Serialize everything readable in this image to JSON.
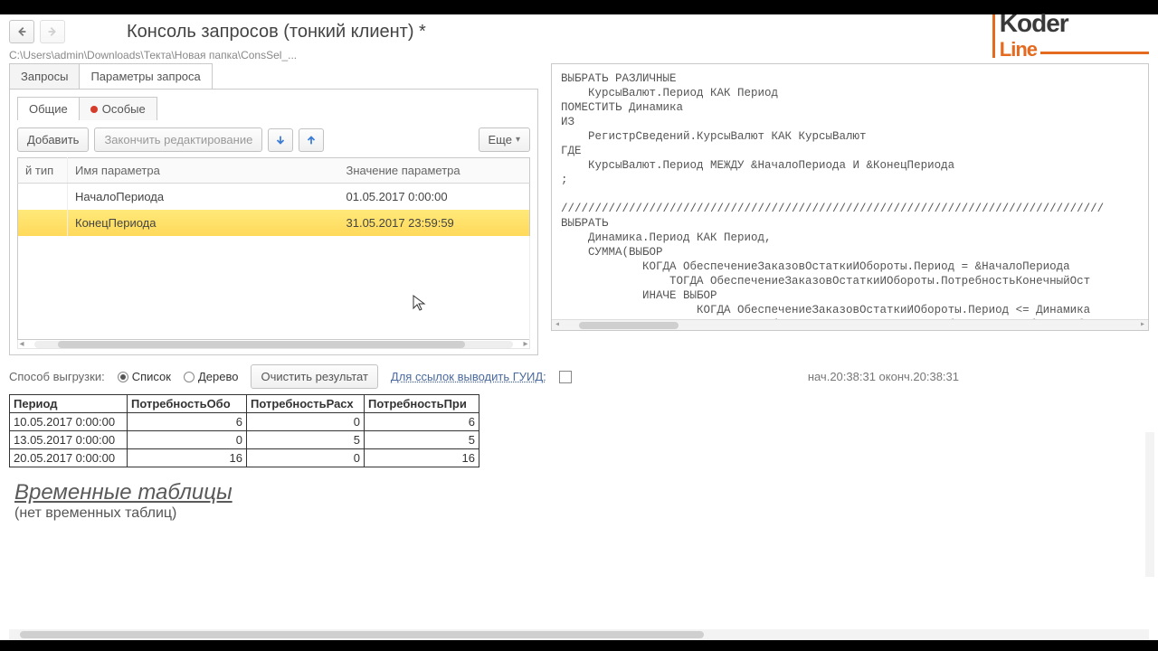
{
  "title": "Консоль запросов (тонкий клиент) *",
  "path": "C:\\Users\\admin\\Downloads\\Текта\\Новая папка\\ConsSel_...",
  "logo": {
    "top": "Koder",
    "bottom": "Line"
  },
  "tabs": {
    "queries": "Запросы",
    "params": "Параметры запроса"
  },
  "innerTabs": {
    "common": "Общие",
    "special": "Особые"
  },
  "toolbar": {
    "add": "Добавить",
    "finishEdit": "Закончить редактирование",
    "more": "Еще"
  },
  "paramHeaders": {
    "type": "й тип",
    "name": "Имя параметра",
    "value": "Значение параметра"
  },
  "params": [
    {
      "name": "НачалоПериода",
      "value": "01.05.2017 0:00:00"
    },
    {
      "name": "КонецПериода",
      "value": "31.05.2017 23:59:59"
    }
  ],
  "code": "ВЫБРАТЬ РАЗЛИЧНЫЕ\n    КурсыВалют.Период КАК Период\nПОМЕСТИТЬ Динамика\nИЗ\n    РегистрСведений.КурсыВалют КАК КурсыВалют\nГДЕ\n    КурсыВалют.Период МЕЖДУ &НачалоПериода И &КонецПериода\n;\n\n////////////////////////////////////////////////////////////////////////////////\nВЫБРАТЬ\n    Динамика.Период КАК Период,\n    СУММА(ВЫБОР\n            КОГДА ОбеспечениеЗаказовОстаткиИОбороты.Период = &НачалоПериода\n                ТОГДА ОбеспечениеЗаказовОстаткиИОбороты.ПотребностьКонечныйОст\n            ИНАЧЕ ВЫБОР\n                    КОГДА ОбеспечениеЗаказовОстаткиИОбороты.Период <= Динамика\n                        ТОГДА ОбеспечениеЗаказовОстаткиИОбороты.ПотребностьОбо",
  "bottom": {
    "exportLabel": "Способ выгрузки:",
    "list": "Список",
    "tree": "Дерево",
    "clear": "Очистить результат",
    "guidLabel": "Для ссылок выводить ГУИД:",
    "timeInfo": "нач.20:38:31  оконч.20:38:31"
  },
  "resultHeaders": [
    "Период",
    "ПотребностьОбо",
    "ПотребностьРасх",
    "ПотребностьПри"
  ],
  "resultHeadersClipped": [
    "Период",
    "ПотребностьОбо",
    "ПотребностьРасх",
    "ПотребностьПри"
  ],
  "resultRows": [
    {
      "period": "10.05.2017 0:00:00",
      "c1": "6",
      "c2": "0",
      "c3": "6"
    },
    {
      "period": "13.05.2017 0:00:00",
      "c1": "0",
      "c2": "5",
      "c3": "5"
    },
    {
      "period": "20.05.2017 0:00:00",
      "c1": "16",
      "c2": "0",
      "c3": "16"
    }
  ],
  "tempTables": {
    "title": "Временные таблицы",
    "none": "(нет временных таблиц)"
  }
}
